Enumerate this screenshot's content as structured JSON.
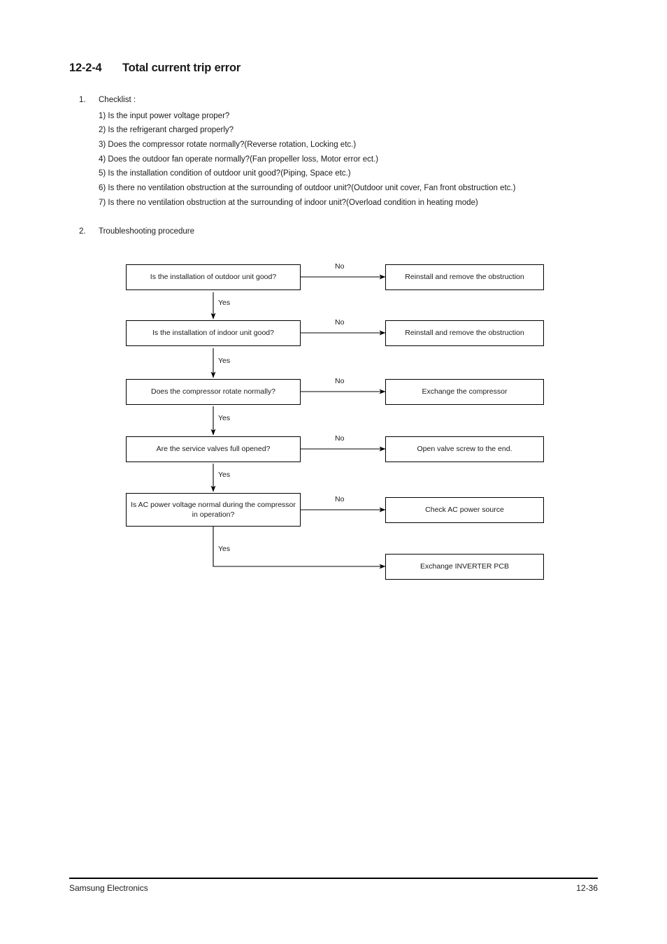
{
  "heading": {
    "number": "12-2-4",
    "title": "Total current trip error"
  },
  "sections": {
    "checklist": {
      "marker": "1.",
      "title": "Checklist :",
      "items": [
        "1) Is the input power voltage proper?",
        "2) Is the refrigerant charged properly?",
        "3) Does the compressor rotate normally?(Reverse rotation, Locking etc.)",
        "4) Does the outdoor fan operate normally?(Fan propeller loss, Motor error ect.)",
        "5) Is the installation condition of outdoor unit good?(Piping, Space etc.)",
        "6) Is there no ventilation obstruction at the surrounding of outdoor unit?(Outdoor unit cover, Fan front obstruction etc.)",
        "7) Is there no ventilation obstruction at the surrounding of indoor unit?(Overload condition in heating mode)"
      ]
    },
    "troubleshooting": {
      "marker": "2.",
      "title": "Troubleshooting procedure"
    }
  },
  "flowchart": {
    "decisions": [
      "Is the installation of outdoor unit good?",
      "Is the installation of indoor unit good?",
      "Does the compressor rotate normally?",
      "Are the service valves full opened?",
      "Is AC power voltage normal during the compressor in operation?"
    ],
    "actions": [
      "Reinstall and remove the obstruction",
      "Reinstall and remove the obstruction",
      "Exchange the compressor",
      "Open valve screw to the end.",
      "Check AC power source",
      "Exchange INVERTER PCB"
    ],
    "no_labels": [
      "No",
      "No",
      "No",
      "No",
      "No"
    ],
    "yes_labels": [
      "Yes",
      "Yes",
      "Yes",
      "Yes",
      "Yes"
    ]
  },
  "footer": {
    "left": "Samsung Electronics",
    "right": "12-36"
  }
}
